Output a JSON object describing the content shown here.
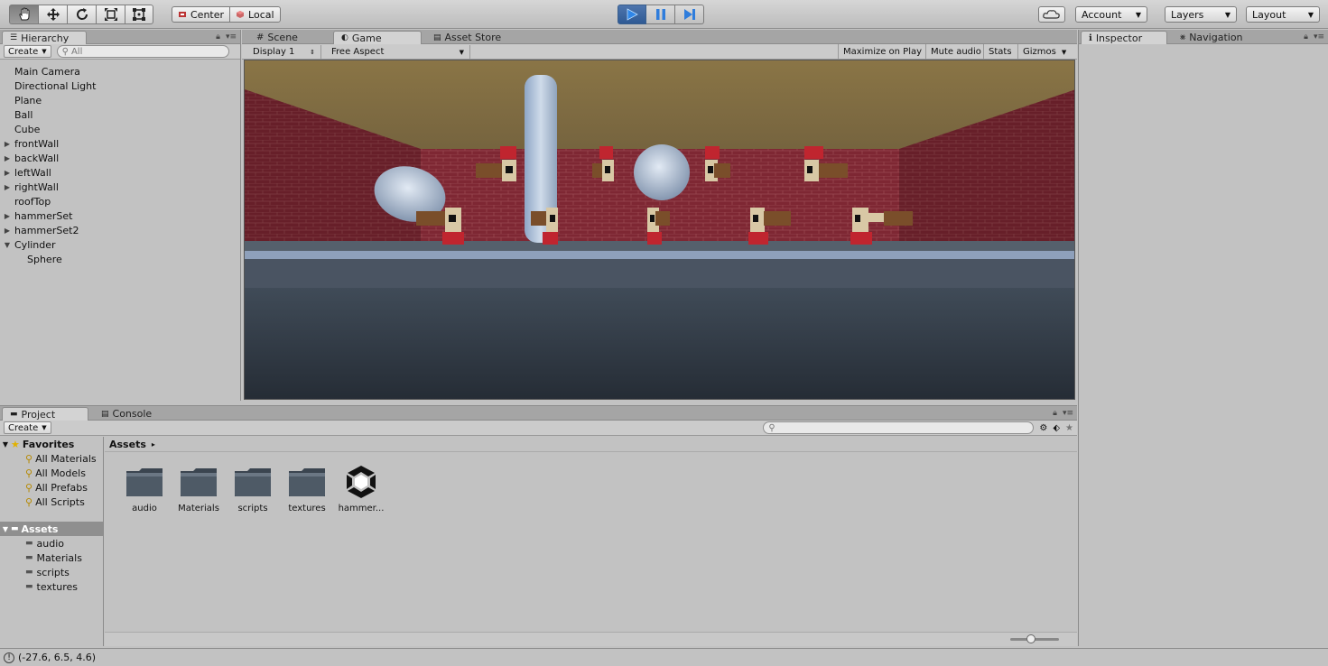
{
  "toolbar": {
    "tools": [
      "hand-tool-icon",
      "move-tool-icon",
      "rotate-tool-icon",
      "scale-tool-icon",
      "rect-tool-icon"
    ],
    "pivot_label": "Center",
    "space_label": "Local",
    "account_label": "Account",
    "layers_label": "Layers",
    "layout_label": "Layout"
  },
  "hierarchy": {
    "tab_label": "Hierarchy",
    "create_label": "Create",
    "search_placeholder": "All",
    "items": [
      {
        "label": "Main Camera",
        "expandable": false,
        "indent": 0
      },
      {
        "label": "Directional Light",
        "expandable": false,
        "indent": 0
      },
      {
        "label": "Plane",
        "expandable": false,
        "indent": 0
      },
      {
        "label": "Ball",
        "expandable": false,
        "indent": 0
      },
      {
        "label": "Cube",
        "expandable": false,
        "indent": 0
      },
      {
        "label": "frontWall",
        "expandable": true,
        "indent": 0
      },
      {
        "label": "backWall",
        "expandable": true,
        "indent": 0
      },
      {
        "label": "leftWall",
        "expandable": true,
        "indent": 0
      },
      {
        "label": "rightWall",
        "expandable": true,
        "indent": 0
      },
      {
        "label": "roofTop",
        "expandable": false,
        "indent": 0
      },
      {
        "label": "hammerSet",
        "expandable": true,
        "indent": 0
      },
      {
        "label": "hammerSet2",
        "expandable": true,
        "indent": 0
      },
      {
        "label": "Cylinder",
        "expandable": true,
        "expanded": true,
        "indent": 0
      },
      {
        "label": "Sphere",
        "expandable": false,
        "indent": 1
      }
    ]
  },
  "center_tabs": {
    "scene": "Scene",
    "game": "Game",
    "asset_store": "Asset Store"
  },
  "game_toolbar": {
    "display": "Display 1",
    "aspect": "Free Aspect",
    "maximize": "Maximize on Play",
    "mute": "Mute audio",
    "stats": "Stats",
    "gizmos": "Gizmos"
  },
  "inspector": {
    "tab_inspector": "Inspector",
    "tab_navigation": "Navigation"
  },
  "project": {
    "tab_project": "Project",
    "tab_console": "Console",
    "create_label": "Create",
    "favorites_label": "Favorites",
    "favorites": [
      "All Materials",
      "All Models",
      "All Prefabs",
      "All Scripts"
    ],
    "assets_label": "Assets",
    "asset_folders": [
      "audio",
      "Materials",
      "scripts",
      "textures"
    ],
    "breadcrumb": "Assets",
    "grid_items": [
      {
        "label": "audio",
        "icon": "folder-icon"
      },
      {
        "label": "Materials",
        "icon": "folder-icon"
      },
      {
        "label": "scripts",
        "icon": "folder-icon"
      },
      {
        "label": "textures",
        "icon": "folder-icon"
      },
      {
        "label": "hammer...",
        "icon": "unity-scene-icon"
      }
    ]
  },
  "status": {
    "message": "(-27.6, 6.5, 4.6)"
  }
}
